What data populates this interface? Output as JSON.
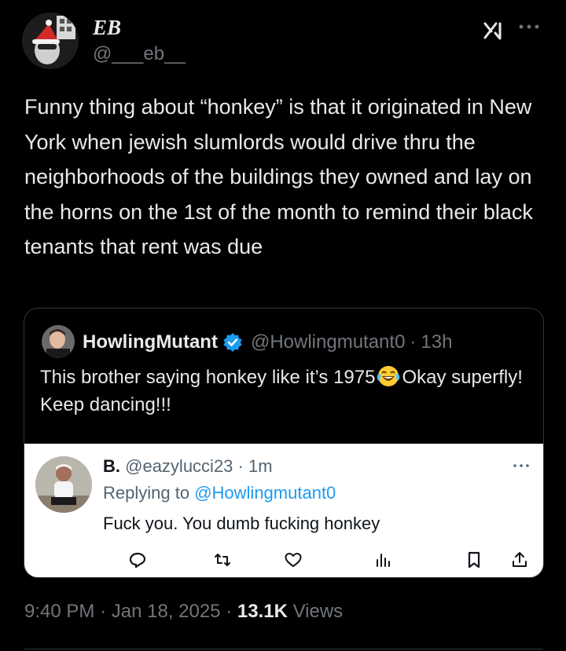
{
  "author": {
    "name": "EB",
    "handle": "@___eb__"
  },
  "tweet": {
    "text": "Funny thing about “honkey” is that it originated in New York when jewish slumlords would drive thru the neighborhoods of the buildings they owned and lay on the horns on the 1st of the month to remind their black tenants that rent was due"
  },
  "quote": {
    "name": "HowlingMutant",
    "handle": "@Howlingmutant0",
    "separator": "·",
    "time": "13h",
    "text_before": "This brother saying honkey like it’s 1975",
    "emoji": "face-with-tears-of-joy",
    "text_after": "Okay superfly!  Keep dancing!!!",
    "embedded": {
      "name": "B.",
      "handle": "@eazylucci23",
      "separator": "·",
      "time": "1m",
      "replying_label": "Replying to",
      "replying_to": "@Howlingmutant0",
      "text": "Fuck you. You dumb fucking honkey"
    }
  },
  "meta": {
    "time": "9:40 PM",
    "sep1": "·",
    "date": "Jan 18, 2025",
    "sep2": "·",
    "views_count": "13.1K",
    "views_label": "Views"
  },
  "icons": {
    "grok": "grok-icon",
    "more": "more-horizontal-icon",
    "verified": "verified-badge-icon",
    "reply": "reply-icon",
    "retweet": "retweet-icon",
    "like": "like-icon",
    "views": "views-icon",
    "bookmark": "bookmark-icon",
    "share": "share-icon"
  },
  "colors": {
    "background": "#000000",
    "text": "#e7e9ea",
    "secondary": "#71767b",
    "accent": "#1d9bf0"
  }
}
